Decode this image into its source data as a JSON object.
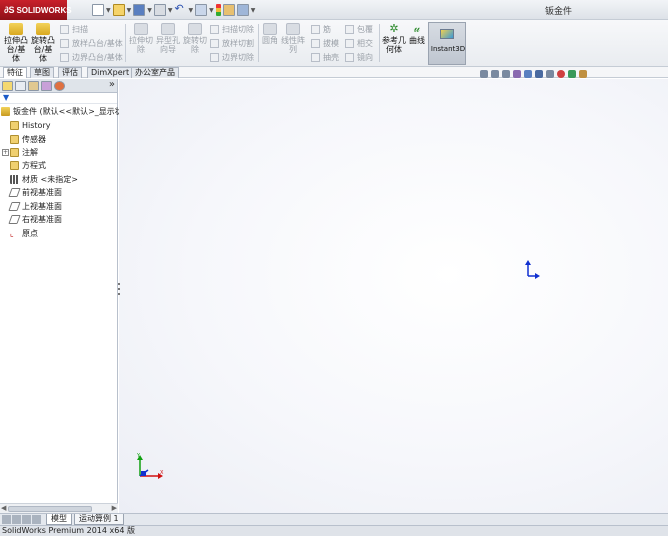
{
  "app": {
    "logo_text": "SOLIDWORKS",
    "doc_title": "钣金件"
  },
  "ribbon": {
    "boss_extrude": "拉伸凸\n台/基\n体",
    "revolve_boss": "旋转凸\n台/基\n体",
    "sweep": "扫描",
    "loft_boss": "放样凸台/基体",
    "boundary_boss": "边界凸台/基体",
    "extruded_cut": "拉伸切\n除",
    "hole_wizard": "异型孔\n向导",
    "revolved_cut": "旋转切\n除",
    "swept_cut": "扫描切除",
    "lofted_cut": "放样切割",
    "boundary_cut": "边界切除",
    "fillet": "圆角",
    "linear_pattern": "线性阵\n列",
    "rib": "筋",
    "draft": "拔模",
    "shell": "抽壳",
    "wrap": "包覆",
    "intersect": "相交",
    "mirror": "镜向",
    "ref_geometry": "参考几\n何体",
    "curves": "曲线",
    "instant3d": "Instant3D"
  },
  "command_tabs": [
    "特征",
    "草图",
    "评估",
    "DimXpert",
    "办公室产品"
  ],
  "feature_tree": {
    "root": "钣金件 (默认<<默认>_显示状",
    "items": [
      {
        "label": "History",
        "icon": "history-icon",
        "expandable": false
      },
      {
        "label": "传感器",
        "icon": "sensor-icon",
        "expandable": false
      },
      {
        "label": "注解",
        "icon": "annotation-icon",
        "expandable": true
      },
      {
        "label": "方程式",
        "icon": "equation-icon",
        "expandable": false
      },
      {
        "label": "材质 <未指定>",
        "icon": "material-icon",
        "expandable": false
      },
      {
        "label": "前视基准面",
        "icon": "plane-icon",
        "expandable": false
      },
      {
        "label": "上视基准面",
        "icon": "plane-icon",
        "expandable": false
      },
      {
        "label": "右视基准面",
        "icon": "plane-icon",
        "expandable": false
      },
      {
        "label": "原点",
        "icon": "origin-icon",
        "expandable": false
      }
    ],
    "expand_glyph": "»"
  },
  "bottom_tabs": [
    "模型",
    "运动算例 1"
  ],
  "status": {
    "text": "SolidWorks Premium 2014 x64 版"
  },
  "colors": {
    "axis_x": "#d01010",
    "axis_y": "#10a010",
    "axis_z": "#1030d0",
    "brand": "#c8202a"
  }
}
